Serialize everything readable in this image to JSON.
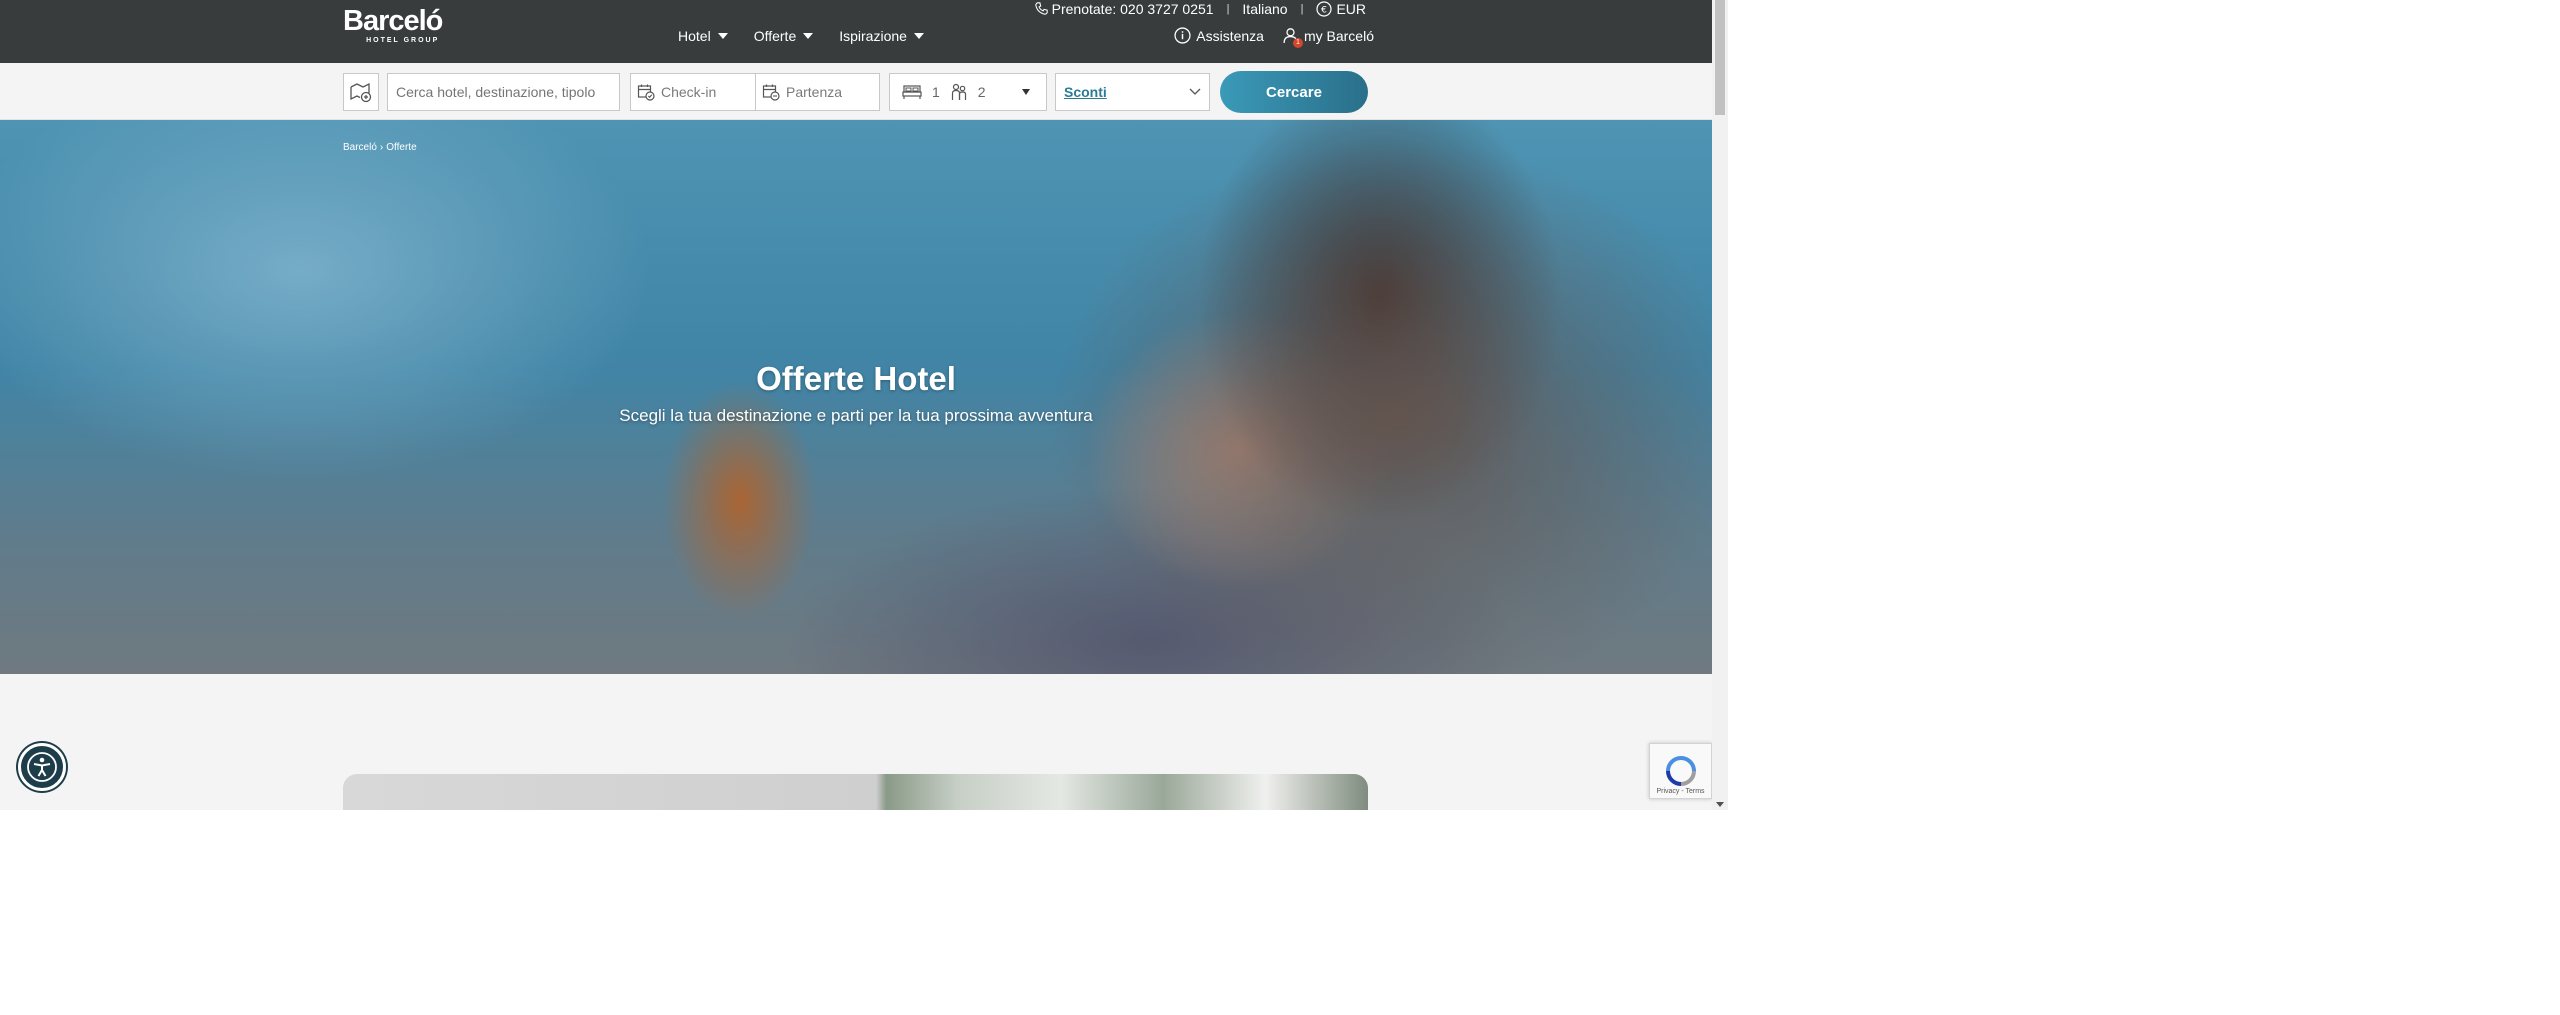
{
  "header": {
    "logo_text": "Barceló",
    "logo_subtext": "HOTEL GROUP",
    "nav": [
      {
        "label": "Hotel"
      },
      {
        "label": "Offerte"
      },
      {
        "label": "Ispirazione"
      }
    ],
    "phone_label": "Prenotate: 020 3727 0251",
    "language": "Italiano",
    "currency": "EUR",
    "help_label": "Assistenza",
    "account_label": "my Barceló",
    "account_badge": "1"
  },
  "search": {
    "destination_placeholder": "Cerca hotel, destinazione, tipolo",
    "checkin_label": "Check-in",
    "checkout_label": "Partenza",
    "rooms": "1",
    "guests": "2",
    "discounts_label": "Sconti",
    "submit_label": "Cercare"
  },
  "hero": {
    "breadcrumb": [
      "Barceló",
      "›",
      "Offerte"
    ],
    "title": "Offerte Hotel",
    "subtitle": "Scegli la tua destinazione e parti per la tua prossima avventura"
  },
  "recaptcha": {
    "links": "Privacy - Terms"
  },
  "colors": {
    "header_bg": "#383c3d",
    "accent": "#2a7c96",
    "page_bg": "#f4f4f4"
  }
}
